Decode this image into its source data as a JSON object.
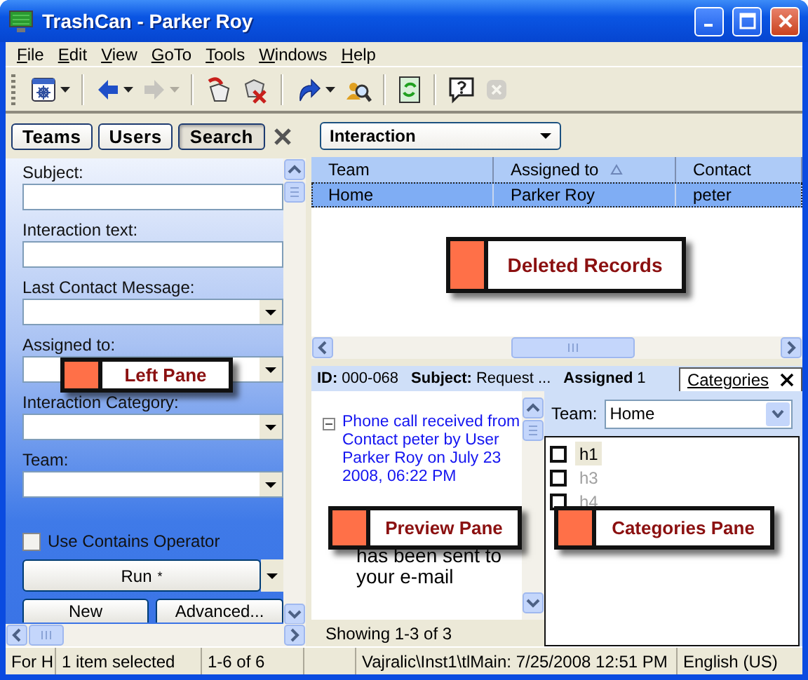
{
  "window": {
    "title": "TrashCan - Parker Roy"
  },
  "menu": [
    {
      "label": "File"
    },
    {
      "label": "Edit"
    },
    {
      "label": "View"
    },
    {
      "label": "GoTo"
    },
    {
      "label": "Tools"
    },
    {
      "label": "Windows"
    },
    {
      "label": "Help"
    }
  ],
  "toolbar": [
    {
      "kind": "new",
      "disabled": false,
      "dropdown": true
    },
    {
      "kind": "separator"
    },
    {
      "kind": "back",
      "disabled": false,
      "dropdown": true
    },
    {
      "kind": "forward",
      "disabled": true,
      "dropdown": true
    },
    {
      "kind": "separator"
    },
    {
      "kind": "restore",
      "disabled": false,
      "dropdown": false
    },
    {
      "kind": "delete",
      "disabled": false,
      "dropdown": false
    },
    {
      "kind": "separator"
    },
    {
      "kind": "redo",
      "disabled": false,
      "dropdown": true
    },
    {
      "kind": "find",
      "disabled": false,
      "dropdown": false
    },
    {
      "kind": "separator"
    },
    {
      "kind": "refresh",
      "disabled": false,
      "dropdown": false
    },
    {
      "kind": "separator"
    },
    {
      "kind": "help",
      "disabled": false,
      "dropdown": false
    },
    {
      "kind": "stop",
      "disabled": true,
      "dropdown": false
    }
  ],
  "left_pane": {
    "tabs": [
      {
        "label": "Teams",
        "selected": false
      },
      {
        "label": "Users",
        "selected": false
      },
      {
        "label": "Search",
        "selected": true
      }
    ],
    "fields": [
      {
        "label": "Subject:",
        "kind": "text"
      },
      {
        "label": "Interaction text:",
        "kind": "text"
      },
      {
        "label": "Last Contact Message:",
        "kind": "combo"
      },
      {
        "label": "Assigned to:",
        "kind": "combo"
      },
      {
        "label": "Interaction Category:",
        "kind": "combo"
      },
      {
        "label": "Team:",
        "kind": "combo"
      }
    ],
    "checkbox": {
      "label": "Use Contains Operator",
      "checked": false
    },
    "run_button": {
      "label": "Run",
      "mark": "*"
    },
    "buttons": [
      {
        "label": "New"
      },
      {
        "label": "Advanced..."
      }
    ],
    "callout": {
      "label": "Left Pane"
    }
  },
  "records": {
    "view": "Interaction",
    "columns": [
      {
        "label": "Team",
        "sorted": false
      },
      {
        "label": "Assigned to",
        "sorted": true
      },
      {
        "label": "Contact",
        "sorted": false
      }
    ],
    "rows": [
      {
        "cells": [
          "Home",
          "Parker Roy",
          "peter"
        ],
        "selected": true
      }
    ],
    "callout": {
      "label": "Deleted Records"
    }
  },
  "details": {
    "fields": [
      {
        "label": "ID:",
        "value": "000-068"
      },
      {
        "label": "Subject:",
        "value": "Request ..."
      },
      {
        "label": "Assigned",
        "value": "1"
      }
    ],
    "tab": {
      "label": "Categories",
      "selected": true
    }
  },
  "preview": {
    "event": {
      "text": "Phone call received from Contact peter by User Parker Roy on July 23 2008, 06:22 PM",
      "expanded": true
    },
    "body": "has been sent to your e-mail",
    "footer": "Showing 1-3 of 3",
    "callout": {
      "label": "Preview Pane"
    }
  },
  "categories": {
    "team_label": "Team:",
    "team": "Home",
    "items": [
      {
        "label": "h1",
        "checked": false,
        "selected": true,
        "disabled": false
      },
      {
        "label": "h3",
        "checked": false,
        "selected": false,
        "disabled": true
      },
      {
        "label": "h4",
        "checked": false,
        "selected": false,
        "disabled": true
      }
    ],
    "callout": {
      "label": "Categories Pane"
    }
  },
  "status_bar": [
    "For H",
    "1 item selected",
    "1-6 of 6",
    "Vajralic\\Inst1\\tlMain: 7/25/2008 12:51 PM",
    "English (US)"
  ]
}
